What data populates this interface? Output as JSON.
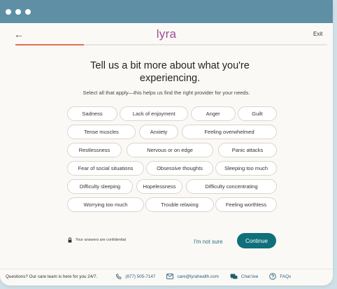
{
  "header": {
    "logo": "lyra",
    "back_glyph": "←",
    "exit_label": "Exit",
    "progress": 0.22
  },
  "main": {
    "heading": "Tell us a bit more about what you're experiencing.",
    "subtitle": "Select all that apply—this helps us find the right provider for your needs.",
    "chips": [
      [
        "Sadness",
        "Lack of enjoyment",
        "Anger",
        "Guilt"
      ],
      [
        "Tense muscles",
        "Anxiety",
        "Feeling overwhelmed"
      ],
      [
        "Restlessness",
        "Nervous or on edge",
        "Panic attacks"
      ],
      [
        "Fear of social situations",
        "Obsessive thoughts",
        "Sleeping too much"
      ],
      [
        "Difficulty sleeping",
        "Hopelessness",
        "Difficulty concentrating"
      ],
      [
        "Worrying too much",
        "Trouble relaxing",
        "Feeling worthless"
      ]
    ]
  },
  "actions": {
    "confidential_text": "Your answers are confidential",
    "not_sure_label": "I'm not sure",
    "continue_label": "Continue"
  },
  "footer": {
    "text": "Questions? Our care team is here for you 24/7.",
    "phone": "(877) 505-7147",
    "email": "care@lyrahealth.com",
    "chat": "Chat live",
    "faqs": "FAQs"
  },
  "colors": {
    "titlebar": "#5f8fa4",
    "brand": "#9a4d91",
    "progress": "#e07150",
    "primary": "#0f6f7a",
    "link": "#2b6f79"
  },
  "icons": {
    "back": "arrow-left-icon",
    "lock": "lock-icon",
    "phone": "phone-icon",
    "email": "mail-icon",
    "chat": "chat-icon",
    "faqs": "help-circle-icon"
  }
}
